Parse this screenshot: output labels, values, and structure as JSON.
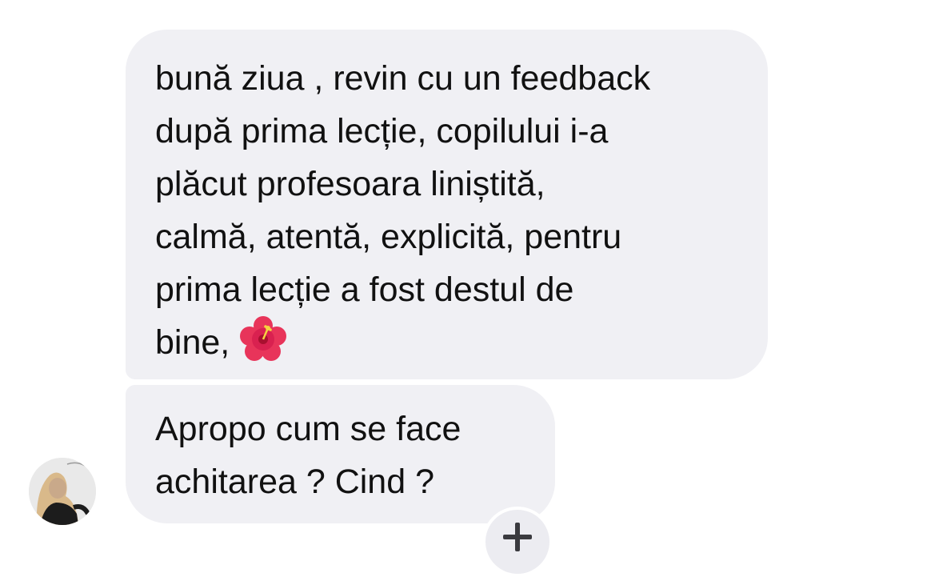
{
  "messages": [
    {
      "lines": [
        "bună ziua , revin cu un feedback",
        "după prima lecție, copilului i-a",
        "plăcut profesoara liniștită,",
        "calmă, atentă, explicită, pentru",
        "prima lecție a fost destul de",
        "bine,"
      ],
      "emoji": "hibiscus-emoji"
    },
    {
      "lines": [
        "Apropo cum se face",
        "achitarea ? Cind ?"
      ]
    }
  ],
  "sender": {
    "avatar": "profile-photo"
  },
  "reaction_button": {
    "icon": "plus-icon"
  },
  "colors": {
    "bubble_bg": "#f0f0f4",
    "text": "#111111",
    "page_bg": "#ffffff"
  }
}
